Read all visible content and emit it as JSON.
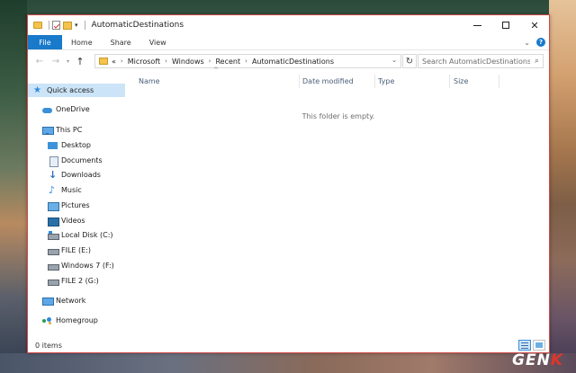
{
  "window": {
    "title": "AutomaticDestinations"
  },
  "ribbon": {
    "tabs": [
      "File",
      "Home",
      "Share",
      "View"
    ]
  },
  "address_bar": {
    "prefix": "«",
    "crumbs": [
      "Microsoft",
      "Windows",
      "Recent",
      "AutomaticDestinations"
    ]
  },
  "search": {
    "placeholder": "Search AutomaticDestinations"
  },
  "nav_pane": {
    "items": [
      {
        "label": "Quick access",
        "icon": "star-icon",
        "selected": true
      },
      {
        "label": "OneDrive",
        "icon": "cloud-icon"
      },
      {
        "label": "This PC",
        "icon": "computer-icon"
      },
      {
        "label": "Desktop",
        "icon": "desktop-icon"
      },
      {
        "label": "Documents",
        "icon": "documents-icon"
      },
      {
        "label": "Downloads",
        "icon": "download-icon"
      },
      {
        "label": "Music",
        "icon": "music-icon"
      },
      {
        "label": "Pictures",
        "icon": "pictures-icon"
      },
      {
        "label": "Videos",
        "icon": "videos-icon"
      },
      {
        "label": "Local Disk (C:)",
        "icon": "system-disk-icon"
      },
      {
        "label": "FILE (E:)",
        "icon": "disk-icon"
      },
      {
        "label": "Windows 7 (F:)",
        "icon": "disk-icon"
      },
      {
        "label": "FILE 2 (G:)",
        "icon": "disk-icon"
      },
      {
        "label": "Network",
        "icon": "network-icon"
      },
      {
        "label": "Homegroup",
        "icon": "homegroup-icon"
      }
    ]
  },
  "content": {
    "columns": [
      "Name",
      "Date modified",
      "Type",
      "Size"
    ],
    "empty_message": "This folder is empty."
  },
  "status_bar": {
    "item_count": "0 items"
  },
  "watermark": {
    "main": "GEN",
    "accent": "K"
  },
  "colors": {
    "accent": "#1979ca",
    "selection": "#cce4f7",
    "window_border": "#d24a4a"
  }
}
